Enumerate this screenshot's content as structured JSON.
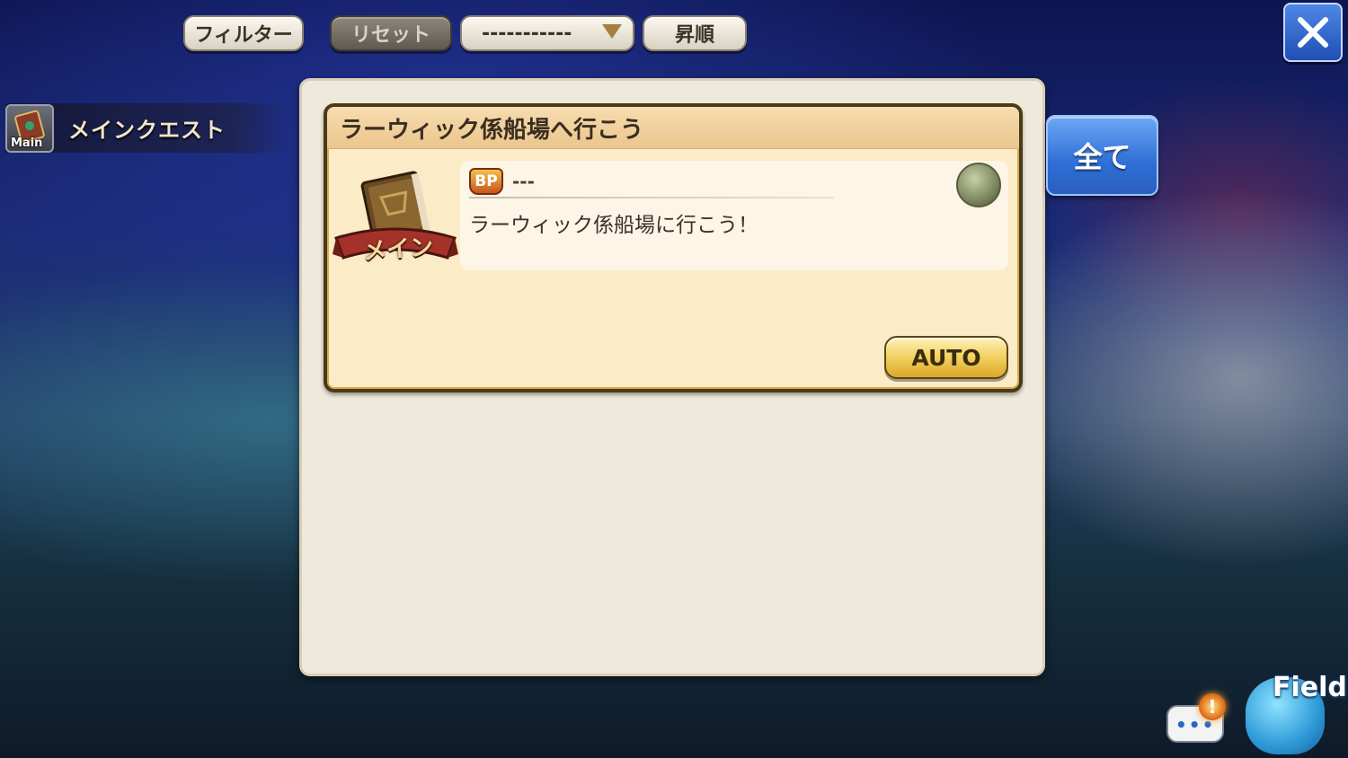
{
  "toolbar": {
    "filter_label": "フィルター",
    "reset_label": "リセット",
    "sort_select_value": "-----------",
    "order_label": "昇順"
  },
  "sidebar": {
    "items": [
      {
        "badge_text": "Main",
        "label": "メインクエスト"
      }
    ]
  },
  "quest": {
    "title": "ラーウィック係船場へ行こう",
    "emblem_label": "メイン",
    "bp_label": "BP",
    "bp_value": "---",
    "description": "ラーウィック係船場に行こう！",
    "auto_label": "AUTO"
  },
  "side_actions": {
    "all_label": "全て"
  },
  "hud": {
    "chat_dots": "•••",
    "chat_alert": "!",
    "field_label": "Field"
  },
  "icons": {
    "close": "close-icon",
    "dropdown": "chevron-down-icon",
    "quest_book": "book-icon",
    "npc": "npc-face-icon",
    "bp": "bp-icon",
    "chat": "chat-bubble-icon",
    "field": "field-creature-icon"
  }
}
